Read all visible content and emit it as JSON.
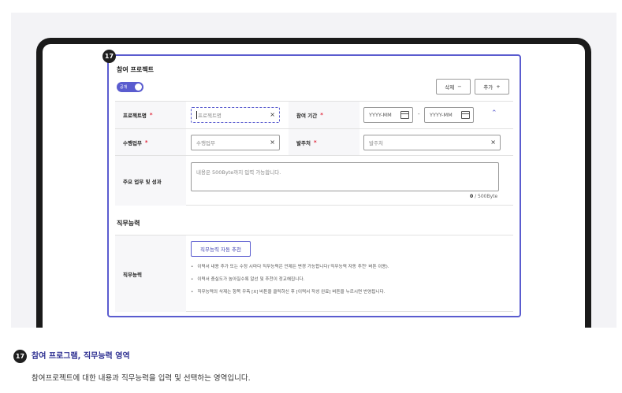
{
  "step_number": "17",
  "panel": {
    "title": "참여 프로젝트",
    "toggle_label": "공개",
    "delete_label": "삭제",
    "delete_icon": "minus-icon",
    "add_label": "추가",
    "add_icon": "plus-icon",
    "rows": {
      "project_name": {
        "label": "프로젝트명",
        "placeholder": "프로젝트명"
      },
      "period": {
        "label": "참여 기간",
        "start_placeholder": "YYYY-MM",
        "end_placeholder": "YYYY-MM",
        "separator": "-"
      },
      "duty": {
        "label": "수행업무",
        "placeholder": "수행업무"
      },
      "client": {
        "label": "발주처",
        "placeholder": "발주처"
      },
      "achievements": {
        "label": "주요 업무 및 성과",
        "placeholder": "내용은 500Byte까지 입력 가능합니다.",
        "count": "0",
        "limit": "/ 500Byte"
      }
    },
    "required_mark": "*",
    "clear_icon": "×",
    "collapse_icon": "⌃",
    "competency": {
      "section_title": "직무능력",
      "label": "직무능력",
      "recommend_button": "직무능력 자동 추천",
      "notes": [
        "이력서 내용 추가 또는 수정 시마다 직무능력은 언제든 변경 가능합니다('직무능력 자동 추천' 버튼 이용).",
        "이력서 충실도가 높아질수록 알선 및 추천이 정교해집니다.",
        "직무능력의 삭제는 항목 우측 [X] 버튼을 클릭하신 후 [이력서 작성 완료] 버튼을 누르시면 반영됩니다."
      ]
    }
  },
  "caption": {
    "number": "17",
    "title": "참여 프로그램, 직무능력 영역",
    "text": "참여프로젝트에 대한 내용과 직무능력을 입력 및 선택하는 영역입니다."
  },
  "colors": {
    "accent": "#5a5ccf",
    "required": "#e1253a",
    "caption_title": "#2f3192"
  }
}
